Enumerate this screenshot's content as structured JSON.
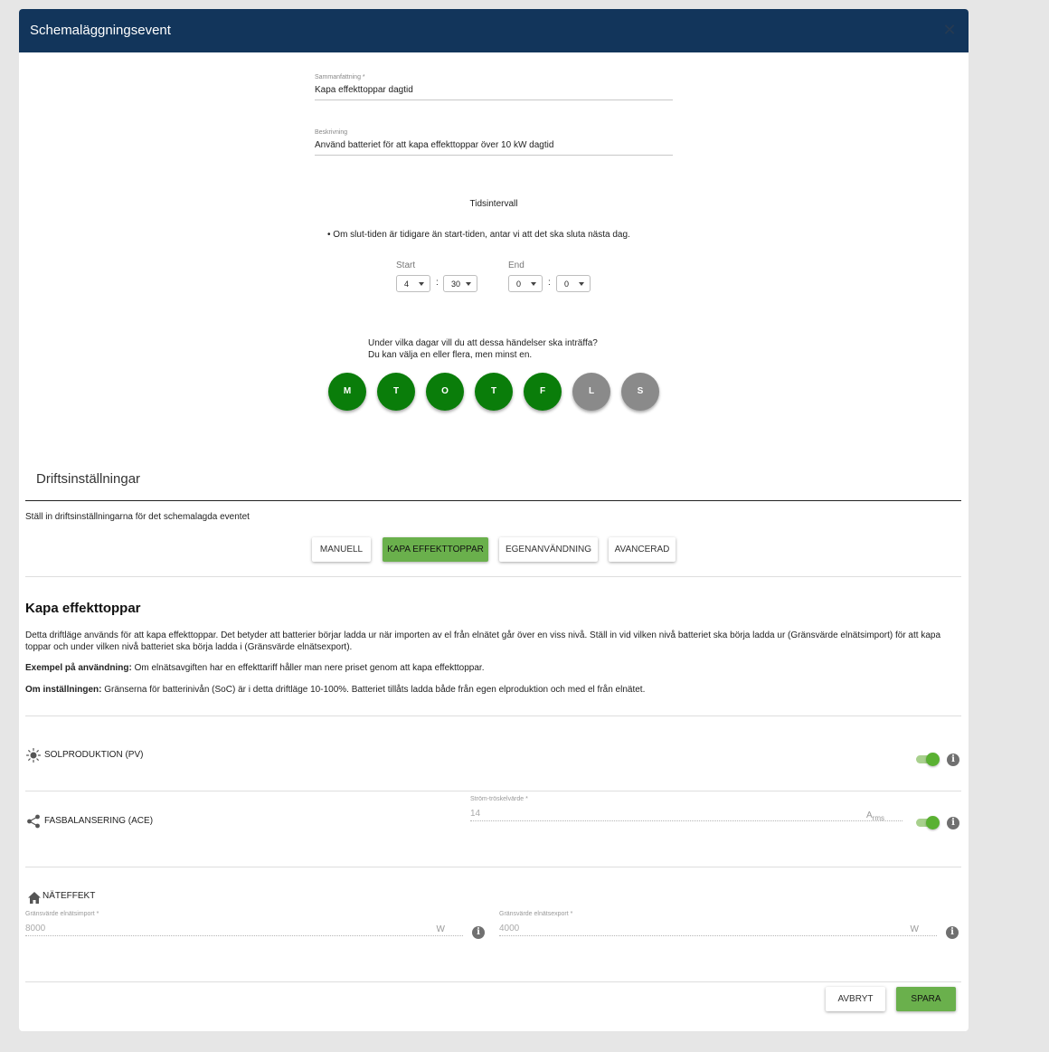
{
  "dialog": {
    "title": "Schemaläggningsevent",
    "close_glyph": "✕"
  },
  "summary": {
    "label": "Sammanfattning *",
    "value": "Kapa effekttoppar dagtid"
  },
  "description": {
    "label": "Beskrivning",
    "value": "Använd batteriet för att kapa effekttoppar över 10 kW dagtid"
  },
  "time_interval": {
    "heading": "Tidsintervall",
    "note": "Om slut-tiden är tidigare än start-tiden, antar vi att det ska sluta nästa dag.",
    "start_label": "Start",
    "start_hour": "4",
    "start_minute": "30",
    "end_label": "End",
    "end_hour": "0",
    "end_minute": "0",
    "separator": ":"
  },
  "days": {
    "question_line1": "Under vilka dagar vill du att dessa händelser ska inträffa?",
    "question_line2": "Du kan välja en eller flera, men minst en.",
    "items": [
      {
        "label": "M",
        "selected": true
      },
      {
        "label": "T",
        "selected": true
      },
      {
        "label": "O",
        "selected": true
      },
      {
        "label": "T",
        "selected": true
      },
      {
        "label": "F",
        "selected": true
      },
      {
        "label": "L",
        "selected": false
      },
      {
        "label": "S",
        "selected": false
      }
    ],
    "selected_color": "#0a7d0a",
    "unselected_color": "#8a8a8a"
  },
  "operation": {
    "section_title": "Driftsinställningar",
    "subtitle": "Ställ in driftsinställningarna för det schemalagda eventet",
    "modes": [
      "MANUELL",
      "KAPA EFFEKTTOPPAR",
      "EGENANVÄNDNING",
      "AVANCERAD"
    ],
    "active_mode": "KAPA EFFEKTTOPPAR",
    "active_color": "#6ab04c"
  },
  "mode_info": {
    "heading": "Kapa effekttoppar",
    "paragraph1": "Detta driftläge används för att kapa effekttoppar. Det betyder att batterier börjar ladda ur när importen av el från elnätet går över en viss nivå. Ställ in vid vilken nivå batteriet ska börja ladda ur (Gränsvärde elnätsimport) för att kapa toppar och under vilken nivå batteriet ska börja ladda i (Gränsvärde elnätsexport).",
    "example_label": "Exempel på användning:",
    "example_text": " Om elnätsavgiften har en effekttariff håller man nere priset genom att kapa effekttoppar.",
    "settings_label": "Om inställningen:",
    "settings_text": " Gränserna för batterinivån (SoC) är i detta driftläge 10-100%. Batteriet tillåts ladda både från egen elproduktion och med el från elnätet."
  },
  "solar": {
    "icon": "sun-icon",
    "label": "SOLPRODUKTION (PV)",
    "enabled": true
  },
  "phase_balancing": {
    "icon": "share-icon",
    "label": "FASBALANSERING (ACE)",
    "threshold_label": "Ström-tröskelvärde *",
    "threshold_value": "14",
    "unit_main": "A",
    "unit_sub": "rms",
    "enabled": true
  },
  "grid_power": {
    "icon": "home-icon",
    "label": "NÄTEFFEKT",
    "import_label": "Gränsvärde elnätsimport *",
    "import_value": "8000",
    "import_unit": "W",
    "export_label": "Gränsvärde elnätsexport *",
    "export_value": "4000",
    "export_unit": "W"
  },
  "footer": {
    "cancel": "AVBRYT",
    "save": "SPARA",
    "save_color": "#6ab04c"
  },
  "info_glyph": "i"
}
